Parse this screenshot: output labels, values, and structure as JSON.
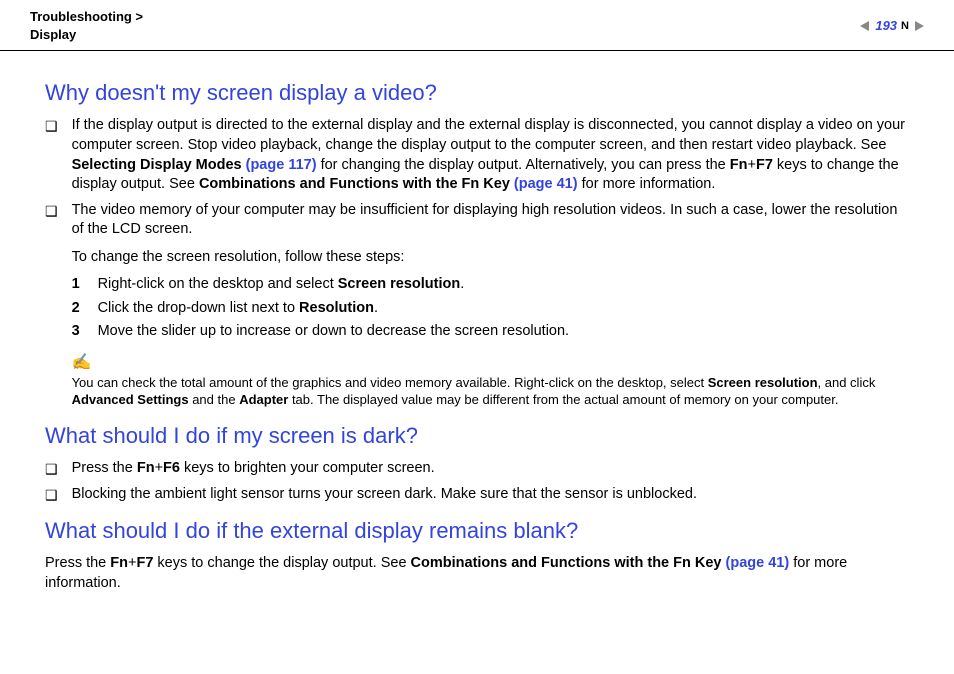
{
  "header": {
    "breadcrumb1": "Troubleshooting >",
    "breadcrumb2": "Display",
    "page": "193",
    "n_label": "N"
  },
  "s1": {
    "heading": "Why doesn't my screen display a video?",
    "b1_pre": "If the display output is directed to the external display and the external display is disconnected, you cannot display a video on your computer screen. Stop video playback, change the display output to the computer screen, and then restart video playback. See ",
    "b1_bold1": "Selecting Display Modes ",
    "b1_link1": "(page 117)",
    "b1_mid": " for changing the display output. Alternatively, you can press the ",
    "b1_fn": "Fn",
    "b1_plus": "+",
    "b1_f7": "F7",
    "b1_after": " keys to change the display output. See ",
    "b1_bold2": "Combinations and Functions with the Fn Key ",
    "b1_link2": "(page 41)",
    "b1_end": " for more information.",
    "b2": "The video memory of your computer may be insufficient for displaying high resolution videos. In such a case, lower the resolution of the LCD screen.",
    "sub_intro": "To change the screen resolution, follow these steps:",
    "step1_pre": "Right-click on the desktop and select ",
    "step1_bold": "Screen resolution",
    "step2_pre": "Click the drop-down list next to ",
    "step2_bold": "Resolution",
    "step3": "Move the slider up to increase or down to decrease the screen resolution.",
    "note_pre": "You can check the total amount of the graphics and video memory available. Right-click on the desktop, select ",
    "note_b1": "Screen resolution",
    "note_mid": ", and click ",
    "note_b2": "Advanced Settings",
    "note_mid2": " and the ",
    "note_b3": "Adapter",
    "note_end": " tab. The displayed value may be different from the actual amount of memory on your computer."
  },
  "s2": {
    "heading": "What should I do if my screen is dark?",
    "b1_pre": "Press the ",
    "b1_fn": "Fn",
    "b1_plus": "+",
    "b1_f6": "F6",
    "b1_post": " keys to brighten your computer screen.",
    "b2": "Blocking the ambient light sensor turns your screen dark. Make sure that the sensor is unblocked."
  },
  "s3": {
    "heading": "What should I do if the external display remains blank?",
    "p_pre": "Press the ",
    "p_fn": "Fn",
    "p_plus": "+",
    "p_f7": "F7",
    "p_mid": " keys to change the display output. See ",
    "p_bold": "Combinations and Functions with the Fn Key ",
    "p_link": "(page 41)",
    "p_end": " for more information."
  }
}
